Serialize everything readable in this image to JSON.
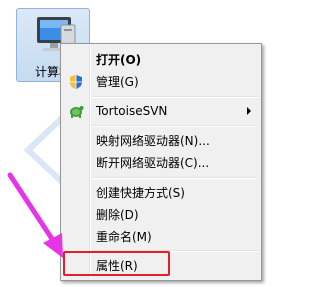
{
  "desktop": {
    "icon_label": "计算机",
    "icon_name": "computer-icon"
  },
  "context_menu": {
    "items": [
      {
        "label": "打开(O)",
        "bold": true
      },
      {
        "label": "管理(G)",
        "icon": "shield-icon"
      },
      {
        "label": "TortoiseSVN",
        "icon": "tortoise-svn-icon",
        "submenu": true
      },
      {
        "label": "映射网络驱动器(N)..."
      },
      {
        "label": "断开网络驱动器(C)..."
      },
      {
        "label": "创建快捷方式(S)"
      },
      {
        "label": "删除(D)"
      },
      {
        "label": "重命名(M)"
      },
      {
        "label": "属性(R)"
      }
    ]
  },
  "annotation": {
    "arrow_color": "#e535e5",
    "highlight_color": "#e0202a"
  }
}
